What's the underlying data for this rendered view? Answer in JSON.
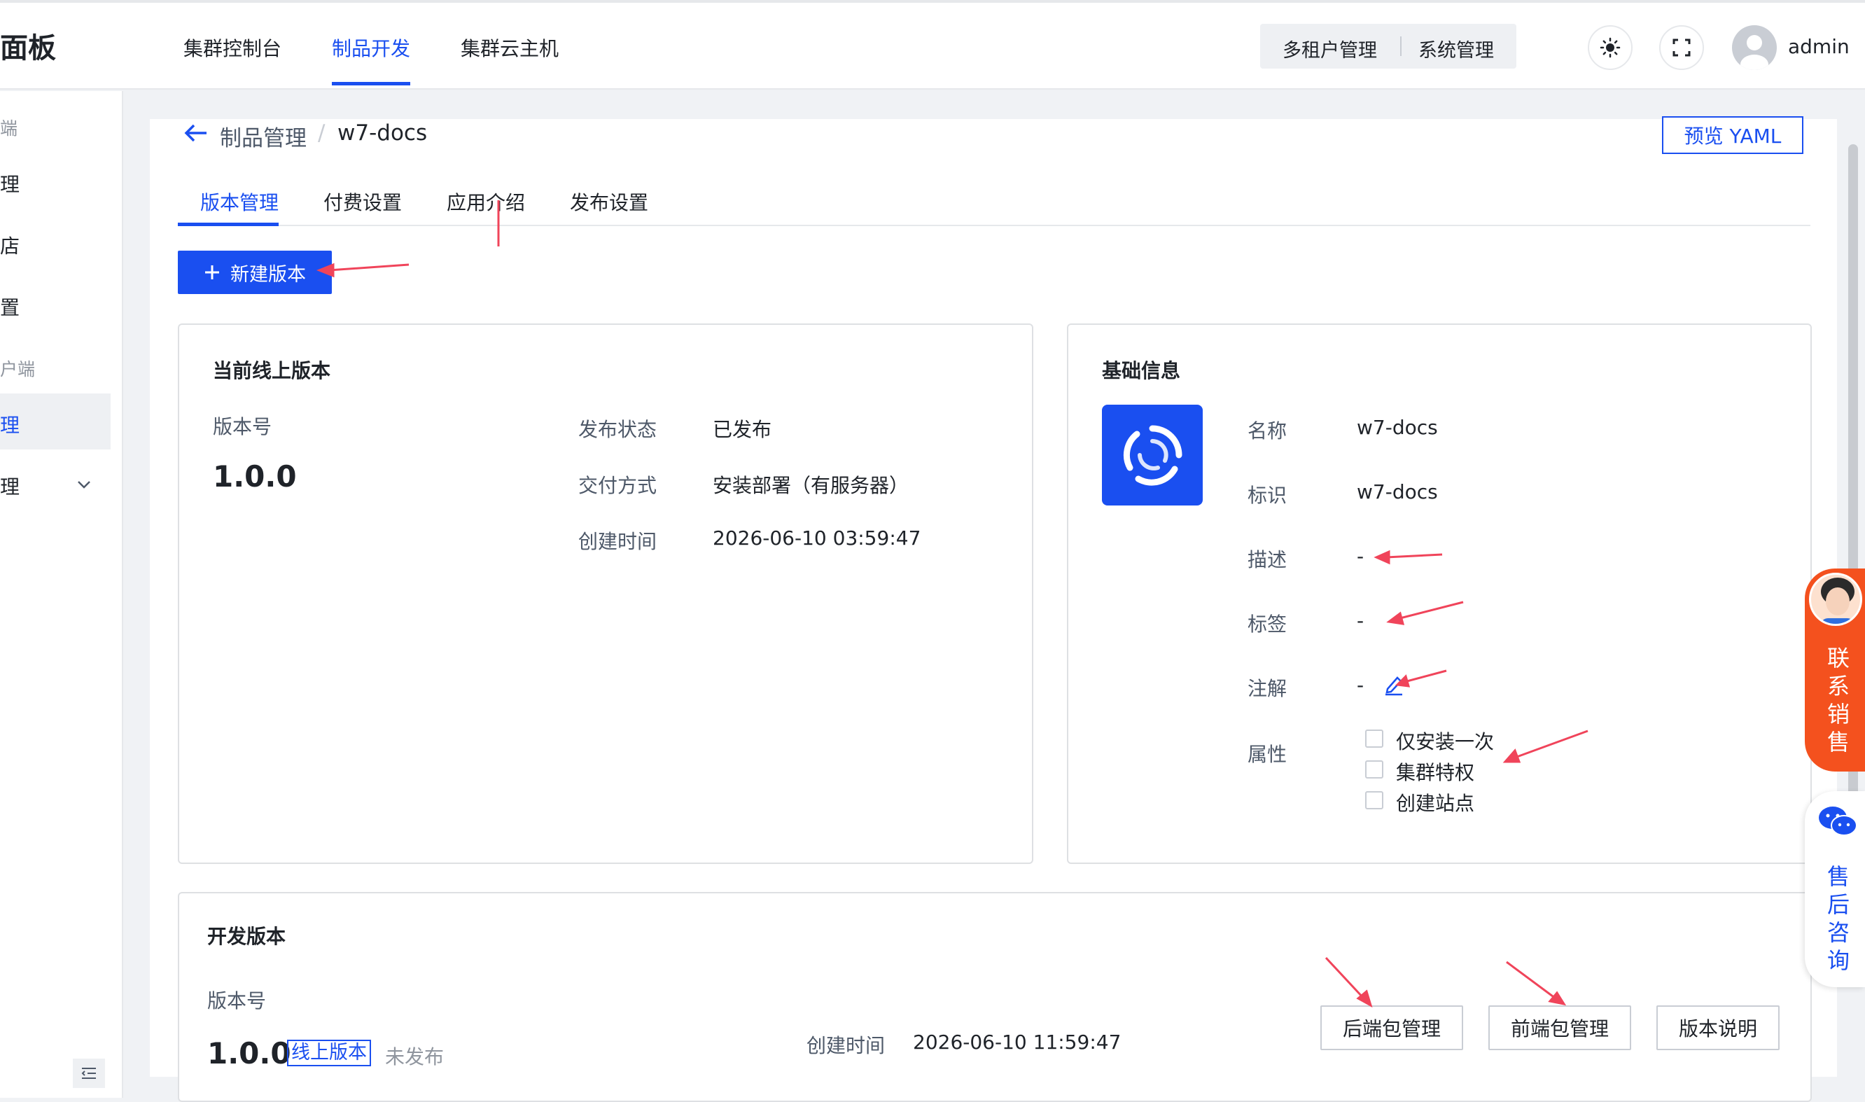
{
  "header": {
    "brand": "面板",
    "nav": [
      "集群控制台",
      "制品开发",
      "集群云主机"
    ],
    "active_nav": "制品开发",
    "top_buttons": [
      "多租户管理",
      "系统管理"
    ],
    "username": "admin"
  },
  "sidebar": {
    "group1": "端",
    "items1": [
      "理",
      "店",
      "置"
    ],
    "group2": "户端",
    "items2": [
      "理",
      "理"
    ]
  },
  "breadcrumb": {
    "parent": "制品管理",
    "separator": "/",
    "current": "w7-docs"
  },
  "preview_yaml": "预览 YAML",
  "tabs": [
    "版本管理",
    "付费设置",
    "应用介绍",
    "发布设置"
  ],
  "new_version": "新建版本",
  "current": {
    "title": "当前线上版本",
    "version_label": "版本号",
    "version": "1.0.0",
    "status_label": "发布状态",
    "status": "已发布",
    "delivery_label": "交付方式",
    "delivery": "安装部署（有服务器）",
    "created_label": "创建时间",
    "created": "2026-06-10 03:59:47"
  },
  "basic": {
    "title": "基础信息",
    "name_label": "名称",
    "name": "w7-docs",
    "id_label": "标识",
    "id": "w7-docs",
    "desc_label": "描述",
    "desc": "-",
    "tags_label": "标签",
    "tags": "-",
    "note_label": "注解",
    "note": "-",
    "attr_label": "属性",
    "attrs": [
      "仅安装一次",
      "集群特权",
      "创建站点"
    ]
  },
  "dev": {
    "title": "开发版本",
    "version_label": "版本号",
    "version": "1.0.0",
    "online_tag": "线上版本",
    "status": "未发布",
    "created_label": "创建时间",
    "created": "2026-06-10 11:59:47",
    "buttons": [
      "后端包管理",
      "前端包管理",
      "版本说明"
    ]
  },
  "float": {
    "sales": [
      "联",
      "系",
      "销",
      "售"
    ],
    "after": [
      "售",
      "后",
      "咨",
      "询"
    ]
  },
  "colors": {
    "primary": "#1a4ff0",
    "accent": "#f4511e",
    "annotation": "#f0445a"
  }
}
